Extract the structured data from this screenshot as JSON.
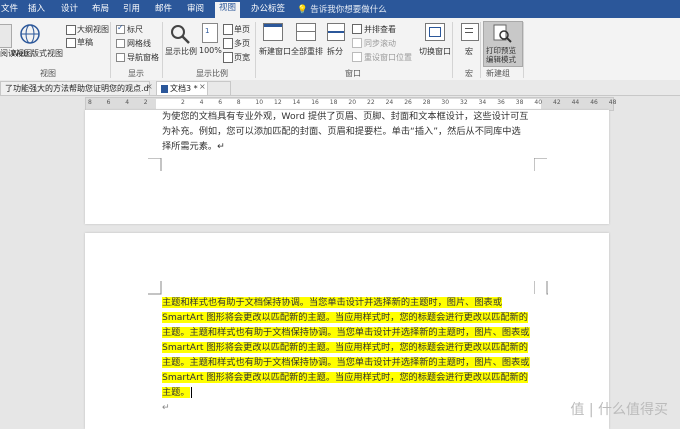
{
  "tabs": [
    "文件",
    "插入",
    "设计",
    "布局",
    "引用",
    "邮件",
    "审阅",
    "视图",
    "办公标签"
  ],
  "active_tab": "视图",
  "tell_me": "告诉我你想要做什么",
  "ribbon": {
    "views": {
      "read_mode": "阅读视图",
      "web_layout": "Web 版式视图",
      "outline": "大纲视图",
      "draft": "草稿",
      "group": "视图"
    },
    "show": {
      "ruler": "标尺",
      "gridlines": "网格线",
      "nav_pane": "导航窗格",
      "group": "显示",
      "ruler_checked": true,
      "gridlines_checked": false,
      "nav_checked": false
    },
    "zoom": {
      "zoom": "显示比例",
      "hundred": "100%",
      "one_page": "单页",
      "multi_page": "多页",
      "page_width": "页宽",
      "group": "显示比例"
    },
    "window": {
      "new_window": "新建窗口",
      "arrange_all": "全部重排",
      "split": "拆分",
      "side_by_side": "并排查看",
      "sync_scroll": "同步滚动",
      "reset_position": "重设窗口位置",
      "switch_windows": "切换窗口",
      "group": "窗口"
    },
    "macros": {
      "label": "宏",
      "group": "宏"
    },
    "new_group": {
      "label1": "打印预览",
      "label2": "编辑模式",
      "group": "新建组"
    }
  },
  "doc_tabs": {
    "tab1": "了功能强大的方法帮助您证明您的观点.docx",
    "tab2": "文档3 *"
  },
  "ruler_ticks": [
    "8",
    "6",
    "4",
    "2",
    "",
    "2",
    "4",
    "6",
    "8",
    "10",
    "12",
    "14",
    "16",
    "18",
    "20",
    "22",
    "24",
    "26",
    "28",
    "30",
    "32",
    "34",
    "36",
    "38",
    "40",
    "42",
    "44",
    "46",
    "48"
  ],
  "page1": {
    "line1": "为使您的文档具有专业外观，Word 提供了页眉、页脚、封面和文本框设计，这些设计可互",
    "line2": "为补充。例如，您可以添加匹配的封面、页眉和提要栏。单击“插入”，然后从不同库中选",
    "line3": "择所需元素。↵"
  },
  "page2": {
    "lines": [
      "主题和样式也有助于文档保持协调。当您单击设计并选择新的主题时，图片、图表或",
      "SmartArt 图形将会更改以匹配新的主题。当应用样式时，您的标题会进行更改以匹配新的",
      "主题。主题和样式也有助于文档保持协调。当您单击设计并选择新的主题时，图片、图表或",
      "SmartArt 图形将会更改以匹配新的主题。当应用样式时，您的标题会进行更改以匹配新的",
      "主题。主题和样式也有助于文档保持协调。当您单击设计并选择新的主题时，图片、图表或",
      "SmartArt 图形将会更改以匹配新的主题。当应用样式时，您的标题会进行更改以匹配新的",
      "主题。"
    ],
    "end_mark": "↵"
  },
  "watermark": "值 | 什么值得买",
  "colors": {
    "accent": "#2b579a",
    "highlight": "#ffff00"
  }
}
